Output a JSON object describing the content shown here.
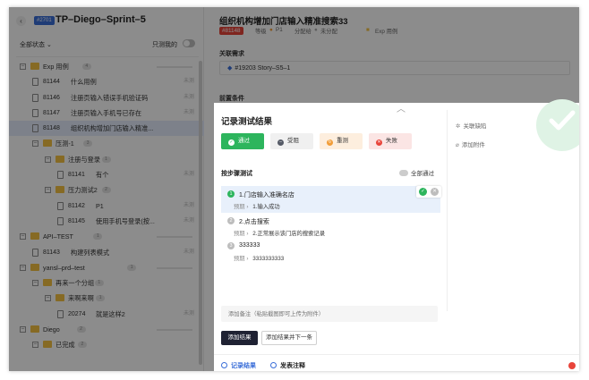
{
  "left": {
    "sprint_badge": "#2701",
    "sprint_title": "TP–Diego–Sprint–5",
    "filter_label": "全部状态 ⌄",
    "only_mine_label": "只测我的",
    "tree": [
      {
        "kind": "folder",
        "level": 0,
        "name": "Exp 用例",
        "count": "4"
      },
      {
        "kind": "case",
        "level": 1,
        "id": "81144",
        "name": "什么用例",
        "status": "未测"
      },
      {
        "kind": "case",
        "level": 1,
        "id": "81146",
        "name": "注册页输入错误手机验证码",
        "status": "未测"
      },
      {
        "kind": "case",
        "level": 1,
        "id": "81147",
        "name": "注册页输入手机号已存在",
        "status": "未测"
      },
      {
        "kind": "case",
        "level": 1,
        "id": "81148",
        "name": "组织机构增加门店输入精准...",
        "status": "",
        "selected": true
      },
      {
        "kind": "folder",
        "level": 1,
        "name": "压测-1",
        "count": "3"
      },
      {
        "kind": "folder",
        "level": 2,
        "name": "注册与登录",
        "count": "1"
      },
      {
        "kind": "case",
        "level": 3,
        "id": "81141",
        "name": "有个",
        "status": "未测"
      },
      {
        "kind": "folder",
        "level": 2,
        "name": "压力测试2",
        "count": "2"
      },
      {
        "kind": "case",
        "level": 3,
        "id": "81142",
        "name": "P1",
        "status": "未测"
      },
      {
        "kind": "case",
        "level": 3,
        "id": "81145",
        "name": "使用手机号登录(按...",
        "status": "未测"
      },
      {
        "kind": "folder",
        "level": 0,
        "name": "API–TEST",
        "count": "1"
      },
      {
        "kind": "case",
        "level": 1,
        "id": "81143",
        "name": "构建列表模式",
        "status": "未测"
      },
      {
        "kind": "folder",
        "level": 0,
        "name": "yansl–prd–test",
        "count": "1"
      },
      {
        "kind": "folder",
        "level": 1,
        "name": "再来一个分组",
        "count": "1"
      },
      {
        "kind": "folder",
        "level": 2,
        "name": "来啊来啊",
        "count": "1"
      },
      {
        "kind": "case",
        "level": 3,
        "id": "20274",
        "name": "就是这样2",
        "status": "未测"
      },
      {
        "kind": "folder",
        "level": 0,
        "name": "Diego",
        "count": "2"
      },
      {
        "kind": "folder",
        "level": 1,
        "name": "已完成",
        "count": "2"
      }
    ]
  },
  "case": {
    "title": "组织机构增加门店输入精准搜索33",
    "id_badge": "#81148",
    "priority_label": "等级",
    "priority_value": "P1",
    "assign_label": "分配给",
    "assignee": "未分配",
    "group": "Exp 用例",
    "related_label": "关联需求",
    "related_story": "#19203 Story–S5–1",
    "precondition_label": "前置条件"
  },
  "modal": {
    "title": "记录测试结果",
    "results": {
      "pass": "通过",
      "blocked": "受阻",
      "retest": "重测",
      "fail": "失败"
    },
    "steps_label": "按步骤测试",
    "all_pass_label": "全部通过",
    "expected_label": "预期",
    "steps": [
      {
        "num": "1",
        "text": "1.门店输入准确名店",
        "expected": "1.输入成功",
        "active": true
      },
      {
        "num": "2",
        "text": "2.点击搜索",
        "expected": "2.正常展示该门店的搜索记录",
        "active": false
      },
      {
        "num": "3",
        "text": "333333",
        "expected": "3333333333",
        "active": false
      }
    ],
    "remark_placeholder": "添加备注（粘贴截图即可上传为附件）",
    "add_result": "添加结果",
    "add_result_next": "添加结果并下一条",
    "tab_record": "记录结果",
    "tab_comment": "发表注释",
    "link_defect": "关联缺陷",
    "add_attachment": "添加附件"
  },
  "colors": {
    "pass": "#2db55d",
    "blocked": "#555a66",
    "retest": "#f29d38",
    "fail": "#e8443a",
    "accent": "#3a6ed8"
  }
}
